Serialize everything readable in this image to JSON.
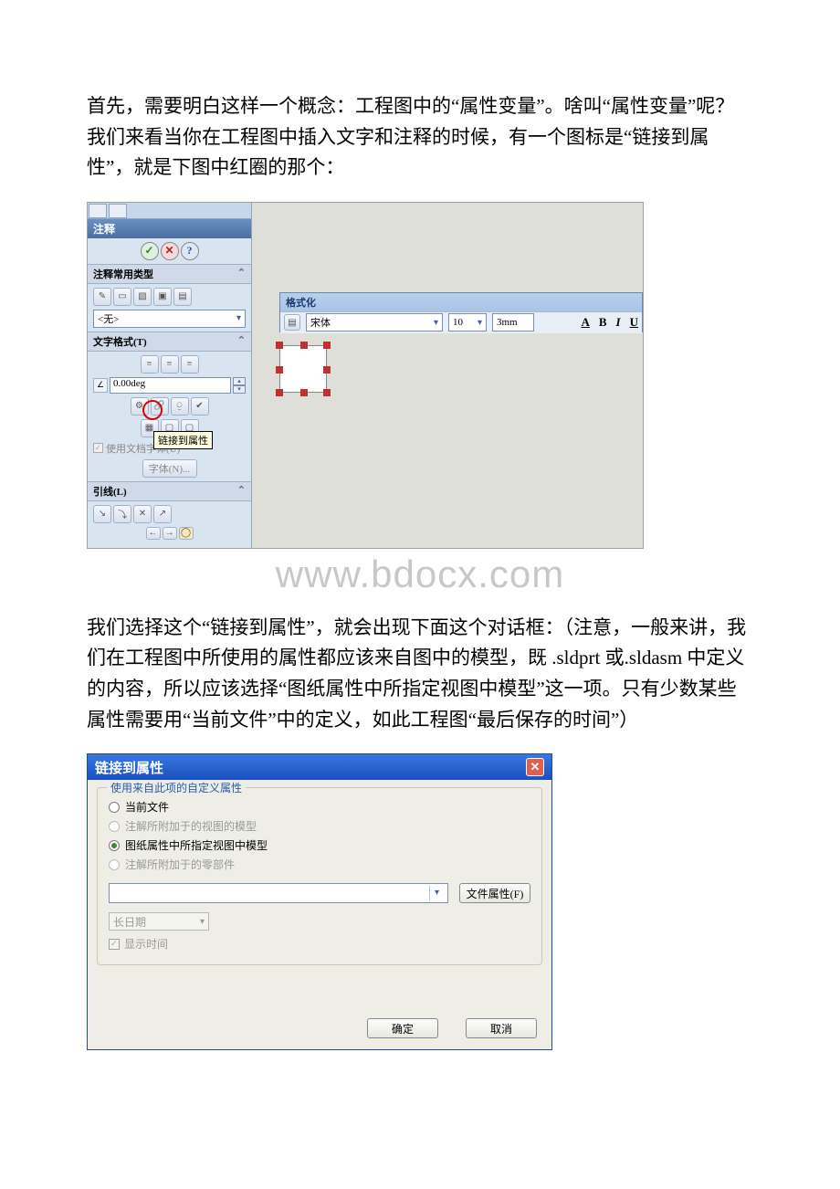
{
  "para1": "首先，需要明白这样一个概念：工程图中的“属性变量”。啥叫“属性变量”呢？我们来看当你在工程图中插入文字和注释的时候，有一个图标是“链接到属性”，就是下图中红圈的那个：",
  "para2": "我们选择这个“链接到属性”，就会出现下面这个对话框：（注意，一般来讲，我们在工程图中所使用的属性都应该来自图中的模型，既 .sldprt 或.sldasm 中定义的内容，所以应该选择“图纸属性中所指定视图中模型”这一项。只有少数某些属性需要用“当前文件”中的定义，如此工程图“最后保存的时间”）",
  "watermark": "www.bdocx.com",
  "panel": {
    "note_title": "注释",
    "sec_common": "注释常用类型",
    "none_option": "<无>",
    "sec_textfmt": "文字格式(T)",
    "angle": "0.00deg",
    "tooltip": "链接到属性",
    "use_doc_font": "使用文档字体(U)",
    "font_btn": "字体(N)...",
    "sec_leader": "引线(L)"
  },
  "fmtbar": {
    "title": "格式化",
    "font": "宋体",
    "size": "10",
    "height": "3mm",
    "A": "A",
    "B": "B",
    "I": "I",
    "U": "U"
  },
  "dialog": {
    "title": "链接到属性",
    "group": "使用来自此项的自定义属性",
    "r1": "当前文件",
    "r2": "注解所附加于的视图的模型",
    "r3": "图纸属性中所指定视图中模型",
    "r4": "注解所附加于的零部件",
    "file_props": "文件属性(F)",
    "date_fmt": "长日期",
    "show_time": "显示时间",
    "ok": "确定",
    "cancel": "取消"
  }
}
